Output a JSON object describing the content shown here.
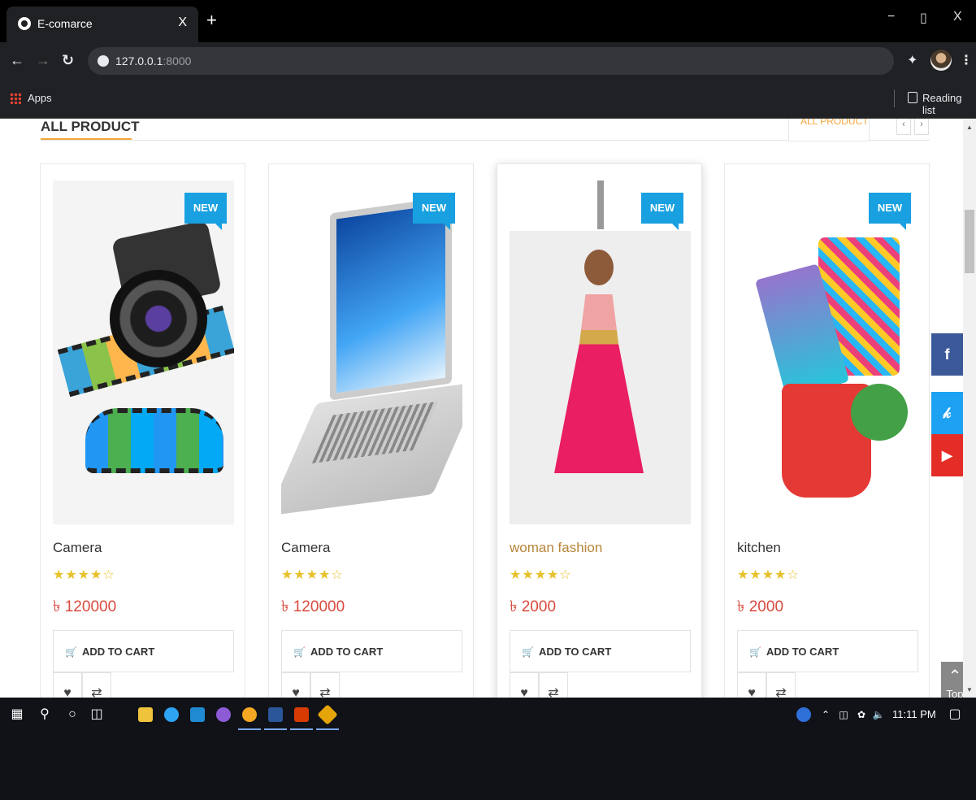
{
  "browser": {
    "tab_title": "E-comarce",
    "tab_close": "X",
    "new_tab": "+",
    "url_host": "127.0.0.1",
    "url_port": ":8000",
    "bookmarks": {
      "apps": "Apps",
      "reading_list": "Reading list"
    },
    "window_controls": {
      "minimize": "−",
      "restore": "▯",
      "close": "X"
    }
  },
  "section": {
    "title": "ALL PRODUCT",
    "tab_label": "ALL PRODUCT",
    "prev": "‹",
    "next": "›"
  },
  "products": [
    {
      "badge": "NEW",
      "name": "Camera",
      "rating": 4,
      "stars": "★★★★☆",
      "price": "৳ 120000",
      "cart": "ADD TO CART"
    },
    {
      "badge": "NEW",
      "name": "Camera",
      "rating": 4,
      "stars": "★★★★☆",
      "price": "৳ 120000",
      "cart": "ADD TO CART"
    },
    {
      "badge": "NEW",
      "name": "woman fashion",
      "rating": 4,
      "stars": "★★★★☆",
      "price": "৳ 2000",
      "cart": "ADD TO CART"
    },
    {
      "badge": "NEW",
      "name": "kitchen",
      "rating": 4,
      "stars": "★★★★☆",
      "price": "৳ 2000",
      "cart": "ADD TO CART"
    }
  ],
  "social": [
    {
      "icon": "facebook-icon",
      "glyph": "f",
      "color": "#3b5998"
    },
    {
      "icon": "twitter-icon",
      "glyph": "❧",
      "color": "#1da1f2"
    },
    {
      "icon": "youtube-icon",
      "glyph": "▶",
      "color": "#e52d27"
    }
  ],
  "to_top": {
    "label": "Top"
  },
  "taskbar": {
    "time": "11:11 PM"
  },
  "colors": {
    "accent": "#f2a53a",
    "badge": "#18a0e1",
    "price": "#d94a3d",
    "stars": "#e7c12a"
  }
}
